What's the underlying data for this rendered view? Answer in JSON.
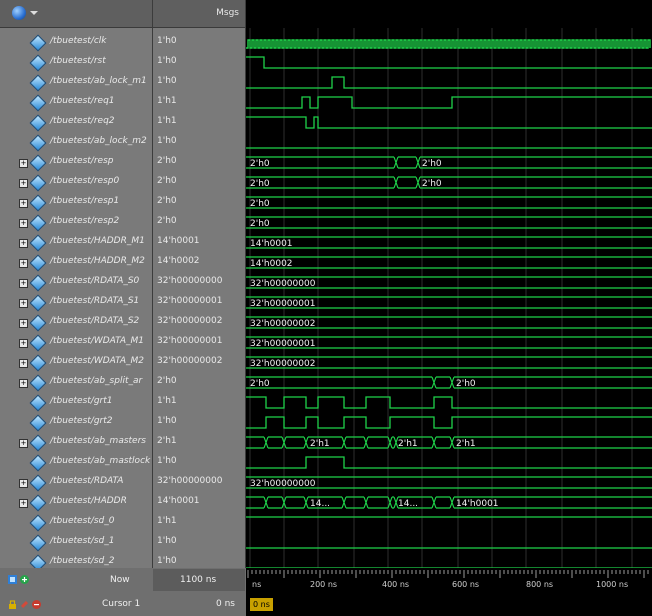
{
  "header": {
    "values_title": "Msgs"
  },
  "signals": [
    {
      "name": "/tbuetest/clk",
      "value": "1'h0",
      "expandable": false
    },
    {
      "name": "/tbuetest/rst",
      "value": "1'h0",
      "expandable": false
    },
    {
      "name": "/tbuetest/ab_lock_m1",
      "value": "1'h0",
      "expandable": false
    },
    {
      "name": "/tbuetest/req1",
      "value": "1'h1",
      "expandable": false
    },
    {
      "name": "/tbuetest/req2",
      "value": "1'h1",
      "expandable": false
    },
    {
      "name": "/tbuetest/ab_lock_m2",
      "value": "1'h0",
      "expandable": false
    },
    {
      "name": "/tbuetest/resp",
      "value": "2'h0",
      "expandable": true
    },
    {
      "name": "/tbuetest/resp0",
      "value": "2'h0",
      "expandable": true
    },
    {
      "name": "/tbuetest/resp1",
      "value": "2'h0",
      "expandable": true
    },
    {
      "name": "/tbuetest/resp2",
      "value": "2'h0",
      "expandable": true
    },
    {
      "name": "/tbuetest/HADDR_M1",
      "value": "14'h0001",
      "expandable": true
    },
    {
      "name": "/tbuetest/HADDR_M2",
      "value": "14'h0002",
      "expandable": true
    },
    {
      "name": "/tbuetest/RDATA_S0",
      "value": "32'h00000000",
      "expandable": true
    },
    {
      "name": "/tbuetest/RDATA_S1",
      "value": "32'h00000001",
      "expandable": true
    },
    {
      "name": "/tbuetest/RDATA_S2",
      "value": "32'h00000002",
      "expandable": true
    },
    {
      "name": "/tbuetest/WDATA_M1",
      "value": "32'h00000001",
      "expandable": true
    },
    {
      "name": "/tbuetest/WDATA_M2",
      "value": "32'h00000002",
      "expandable": true
    },
    {
      "name": "/tbuetest/ab_split_ar",
      "value": "2'h0",
      "expandable": true
    },
    {
      "name": "/tbuetest/grt1",
      "value": "1'h1",
      "expandable": false
    },
    {
      "name": "/tbuetest/grt2",
      "value": "1'h0",
      "expandable": false
    },
    {
      "name": "/tbuetest/ab_masters",
      "value": "2'h1",
      "expandable": true
    },
    {
      "name": "/tbuetest/ab_mastlock",
      "value": "1'h0",
      "expandable": false
    },
    {
      "name": "/tbuetest/RDATA",
      "value": "32'h00000000",
      "expandable": true
    },
    {
      "name": "/tbuetest/HADDR",
      "value": "14'h0001",
      "expandable": true
    },
    {
      "name": "/tbuetest/sd_0",
      "value": "1'h1",
      "expandable": false
    },
    {
      "name": "/tbuetest/sd_1",
      "value": "1'h0",
      "expandable": false
    },
    {
      "name": "/tbuetest/sd_2",
      "value": "1'h0",
      "expandable": false
    }
  ],
  "wave_labels": {
    "resp": [
      "2'h0",
      "2'h0"
    ],
    "resp0": [
      "2'h0",
      "2'h0"
    ],
    "resp1": [
      "2'h0"
    ],
    "resp2": [
      "2'h0"
    ],
    "haddr_m1": [
      "14'h0001"
    ],
    "haddr_m2": [
      "14'h0002"
    ],
    "rdata_s0": [
      "32'h00000000"
    ],
    "rdata_s1": [
      "32'h00000001"
    ],
    "rdata_s2": [
      "32'h00000002"
    ],
    "wdata_m1": [
      "32'h00000001"
    ],
    "wdata_m2": [
      "32'h00000002"
    ],
    "split": [
      "2'h0",
      "2'h0"
    ],
    "masters": [
      "2'h1",
      "2'h1",
      "2'h1"
    ],
    "rdata": [
      "32'h00000000"
    ],
    "haddr": [
      "14...",
      "14...",
      "14'h0001"
    ]
  },
  "bottom": {
    "now_label": "Now",
    "now_value": "1100 ns",
    "cursor_label": "Cursor 1",
    "cursor_value": "0 ns",
    "cursor_tag": "0 ns",
    "time_ticks": [
      "ns",
      "200 ns",
      "400 ns",
      "600 ns",
      "800 ns",
      "1000 ns"
    ]
  },
  "colors": {
    "wave": "#1fd24a",
    "grid": "#3a3a3a",
    "pane": "#7a7a7a"
  }
}
